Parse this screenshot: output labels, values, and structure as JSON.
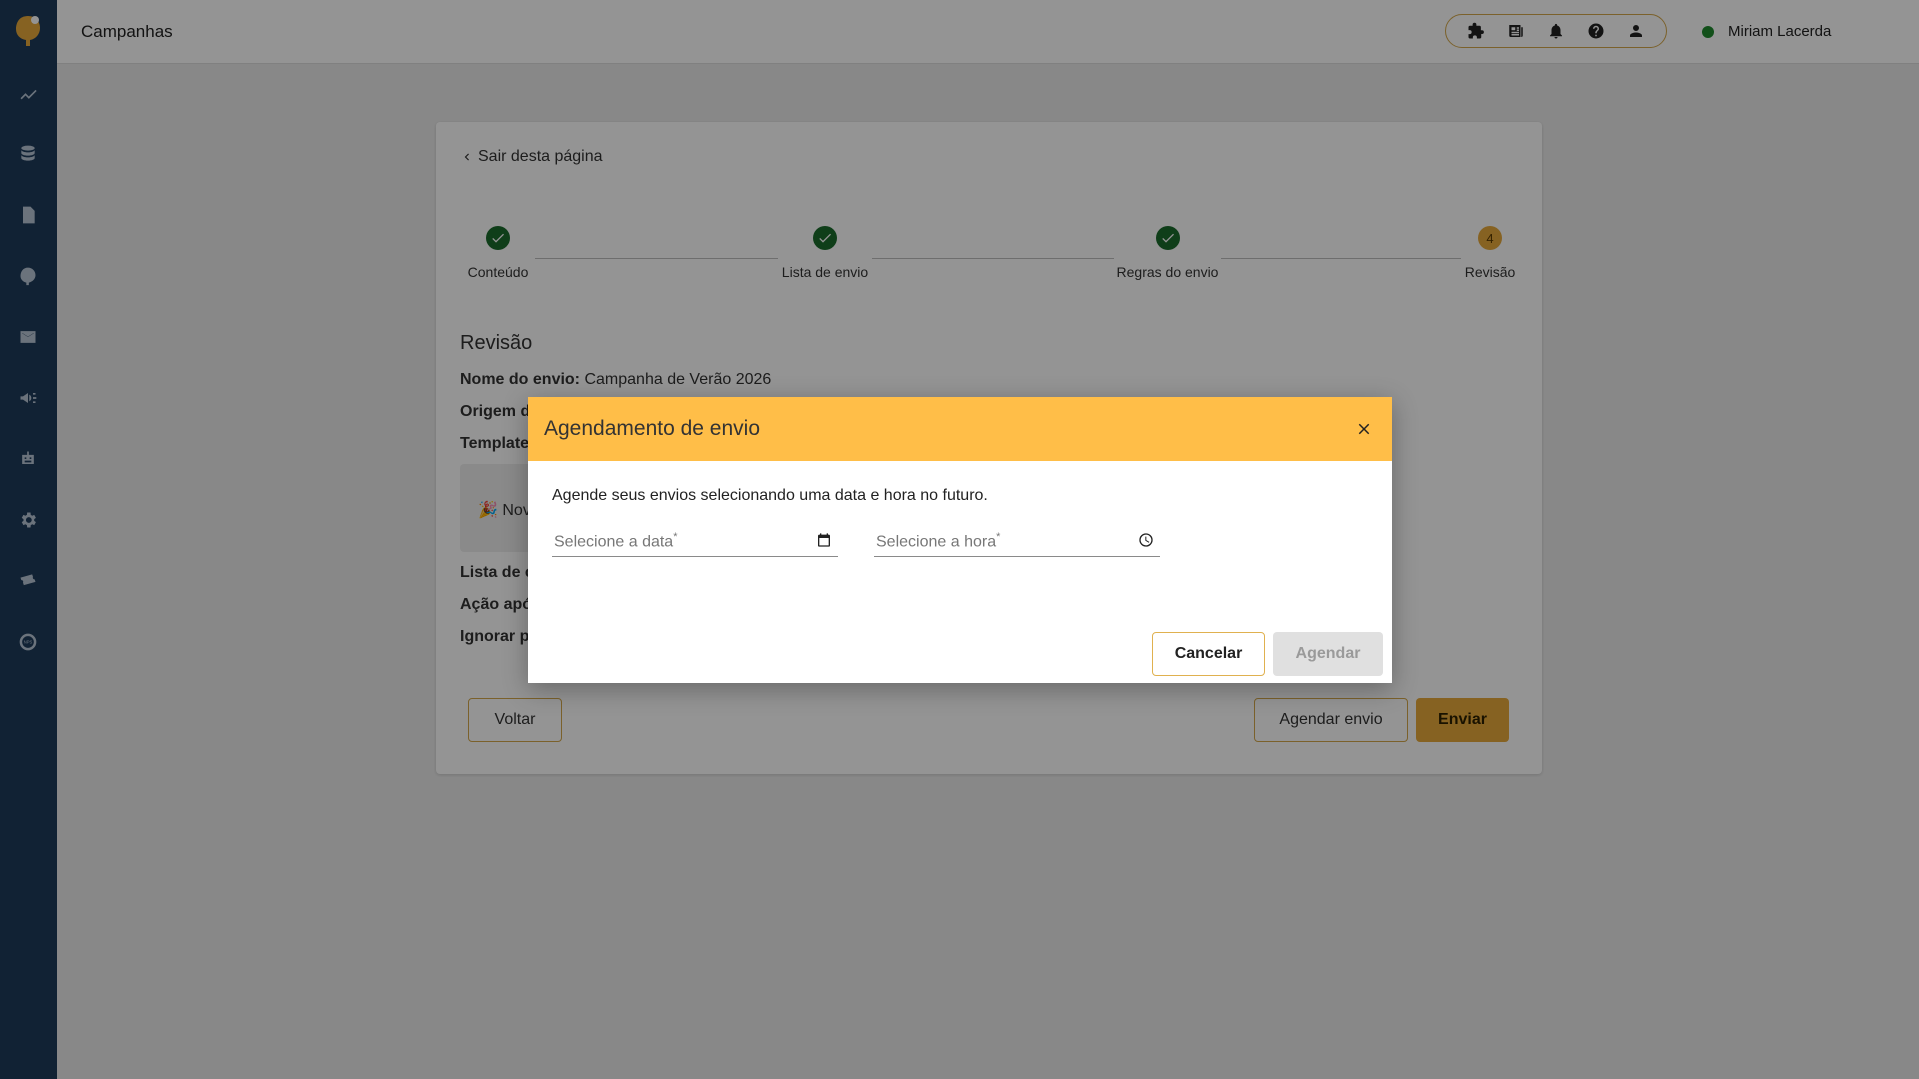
{
  "app": {
    "page_title": "Campanhas",
    "user_name": "Miriam Lacerda",
    "status_color": "#1f8a2e",
    "accent_color": "#ffbe48"
  },
  "sidebar": {
    "items": [
      {
        "icon": "analytics-icon"
      },
      {
        "icon": "database-icon"
      },
      {
        "icon": "document-icon"
      },
      {
        "icon": "brand-icon"
      },
      {
        "icon": "mail-icon"
      },
      {
        "icon": "megaphone-icon"
      },
      {
        "icon": "robot-icon"
      },
      {
        "icon": "gear-icon"
      },
      {
        "icon": "ticket-icon"
      },
      {
        "icon": "nps-icon"
      }
    ]
  },
  "topbar_icons": [
    "puzzle-icon",
    "news-icon",
    "bell-icon",
    "help-icon",
    "user-icon"
  ],
  "page": {
    "back_label": "Sair desta página",
    "steps": [
      {
        "label": "Conteúdo",
        "state": "done"
      },
      {
        "label": "Lista de envio",
        "state": "done"
      },
      {
        "label": "Regras do envio",
        "state": "done"
      },
      {
        "label": "Revisão",
        "state": "active",
        "number": "4"
      }
    ],
    "section_title": "Revisão",
    "fields": {
      "send_name_label": "Nome do envio:",
      "send_name_value": "Campanha de Verão 2026",
      "origin_label": "Origem de",
      "template_label": "Template",
      "template_preview": "🎉 Nov",
      "list_label": "Lista de c",
      "action_label": "Ação apó",
      "ignore_label": "Ignorar pr"
    },
    "buttons": {
      "back": "Voltar",
      "schedule": "Agendar envio",
      "send": "Enviar"
    }
  },
  "dialog": {
    "title": "Agendamento de envio",
    "description": "Agende seus envios selecionando uma data e hora no futuro.",
    "date_placeholder": "Selecione a data",
    "time_placeholder": "Selecione a hora",
    "required_mark": "*",
    "cancel_label": "Cancelar",
    "confirm_label": "Agendar"
  }
}
